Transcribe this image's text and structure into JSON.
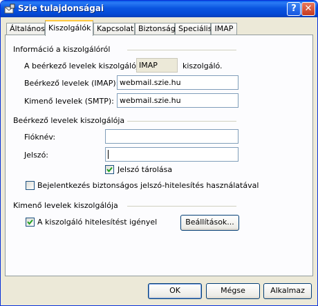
{
  "window": {
    "title": "Szie tulajdonságai",
    "icons": {
      "app": "mail-account-icon",
      "help": "help-icon",
      "close": "close-icon"
    },
    "help_glyph": "?",
    "close_glyph": "✕"
  },
  "tabs": [
    {
      "label": "Általános",
      "active": false
    },
    {
      "label": "Kiszolgálók",
      "active": true
    },
    {
      "label": "Kapcsolat",
      "active": false
    },
    {
      "label": "Biztonság",
      "active": false
    },
    {
      "label": "Speciális",
      "active": false
    },
    {
      "label": "IMAP",
      "active": false
    }
  ],
  "server_info": {
    "heading": "Információ a kiszolgálóról",
    "incoming_type_label": "A beérkező levelek kiszolgálója",
    "incoming_type_value": "IMAP",
    "incoming_type_suffix": "kiszolgáló.",
    "imap_label": "Beérkező levelek (IMAP):",
    "imap_value": "webmail.szie.hu",
    "smtp_label": "Kimenő levelek (SMTP):",
    "smtp_value": "webmail.szie.hu"
  },
  "incoming_server": {
    "heading": "Beérkező levelek kiszolgálója",
    "account_label": "Fióknév:",
    "account_value": "",
    "password_label": "Jelszó:",
    "password_value": "",
    "remember_password_label": "Jelszó tárolása",
    "remember_password_checked": true,
    "spa_label": "Bejelentkezés biztonságos jelszó-hitelesítés használatával",
    "spa_checked": false
  },
  "outgoing_server": {
    "heading": "Kimenő levelek kiszolgálója",
    "auth_label": "A kiszolgáló hitelesítést igényel",
    "auth_checked": true,
    "settings_button": "Beállítások..."
  },
  "footer": {
    "ok": "OK",
    "cancel": "Mégse",
    "apply": "Alkalmaz"
  },
  "colors": {
    "titlebar": "#0b55e0",
    "dialog_bg": "#ece9d8",
    "tab_highlight": "#ffc83c",
    "check_mark": "#21a121"
  }
}
